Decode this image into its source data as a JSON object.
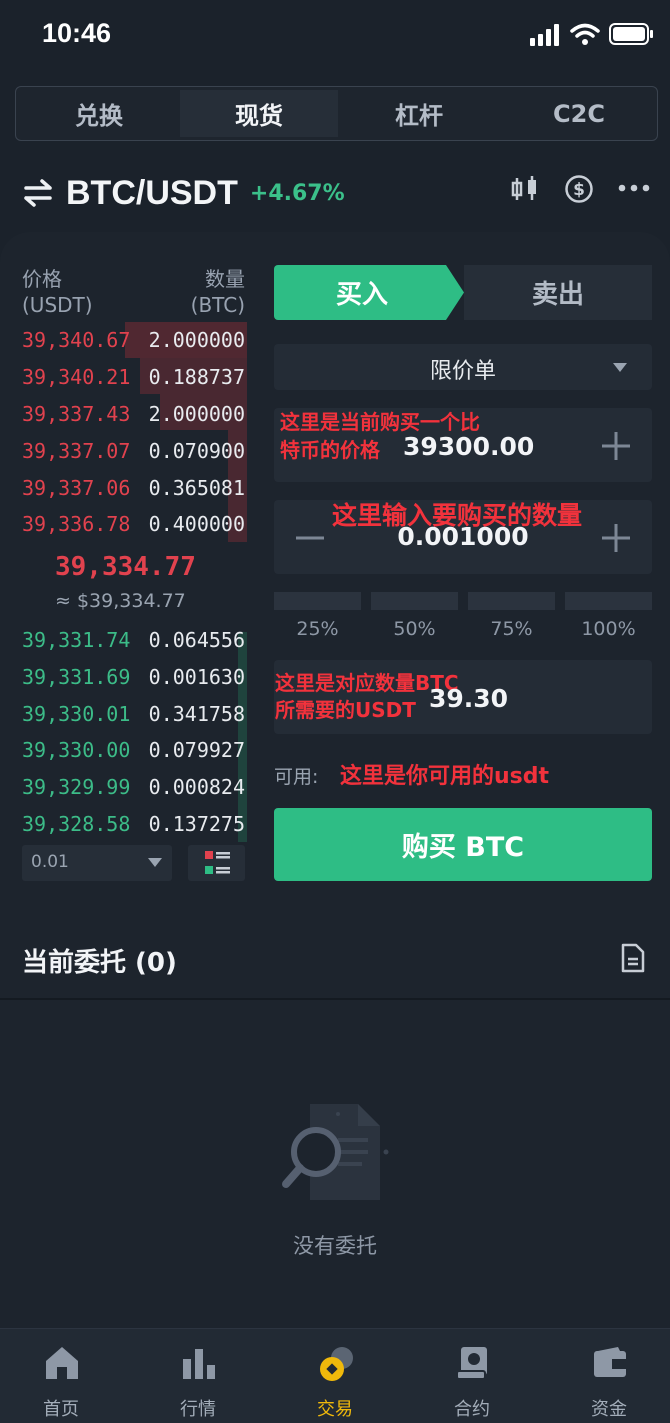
{
  "status_bar": {
    "time": "10:46"
  },
  "tabs": [
    {
      "label": "兑换",
      "active": false
    },
    {
      "label": "现货",
      "active": true
    },
    {
      "label": "杠杆",
      "active": false
    },
    {
      "label": "C2C",
      "active": false
    }
  ],
  "pair": {
    "name": "BTC/USDT",
    "change": "+4.67%"
  },
  "order_book": {
    "price_header": "价格",
    "price_unit": "(USDT)",
    "qty_header": "数量",
    "qty_unit": "(BTC)",
    "asks": [
      {
        "price": "39,340.67",
        "qty": "2.000000"
      },
      {
        "price": "39,340.21",
        "qty": "0.188737"
      },
      {
        "price": "39,337.43",
        "qty": "2.000000"
      },
      {
        "price": "39,337.07",
        "qty": "0.070900"
      },
      {
        "price": "39,337.06",
        "qty": "0.365081"
      },
      {
        "price": "39,336.78",
        "qty": "0.400000"
      }
    ],
    "last_price": "39,334.77",
    "last_price_usd": "≈ $39,334.77",
    "bids": [
      {
        "price": "39,331.74",
        "qty": "0.064556"
      },
      {
        "price": "39,331.69",
        "qty": "0.001630"
      },
      {
        "price": "39,330.01",
        "qty": "0.341758"
      },
      {
        "price": "39,330.00",
        "qty": "0.079927"
      },
      {
        "price": "39,329.99",
        "qty": "0.000824"
      },
      {
        "price": "39,328.58",
        "qty": "0.137275"
      }
    ],
    "precision": "0.01"
  },
  "trade_form": {
    "buy_label": "买入",
    "sell_label": "卖出",
    "order_type": "限价单",
    "price_value": "39300.00",
    "price_note_line1": "这里是当前购买一个比",
    "price_note_line2": "特币的价格",
    "amount_value": "0.001000",
    "amount_note": "这里输入要购买的数量",
    "percents": [
      "25%",
      "50%",
      "75%",
      "100%"
    ],
    "total_value": "39.30",
    "total_note_line1": "这里是对应数量BTC",
    "total_note_line2": "所需要的USDT",
    "available_label": "可用:",
    "available_note": "这里是你可用的usdt",
    "submit_label": "购买 BTC"
  },
  "orders": {
    "title": "当前委托 (0)",
    "empty_text": "没有委托"
  },
  "bottom_nav": [
    {
      "label": "首页",
      "icon": "home-icon",
      "active": false
    },
    {
      "label": "行情",
      "icon": "market-chart-icon",
      "active": false
    },
    {
      "label": "交易",
      "icon": "trade-coin-icon",
      "active": true
    },
    {
      "label": "合约",
      "icon": "contract-icon",
      "active": false
    },
    {
      "label": "资金",
      "icon": "wallet-icon",
      "active": false
    }
  ],
  "colors": {
    "green": "#2ebd85",
    "red": "#e1424e",
    "annotation": "#f2323c",
    "background": "#1b222b"
  }
}
